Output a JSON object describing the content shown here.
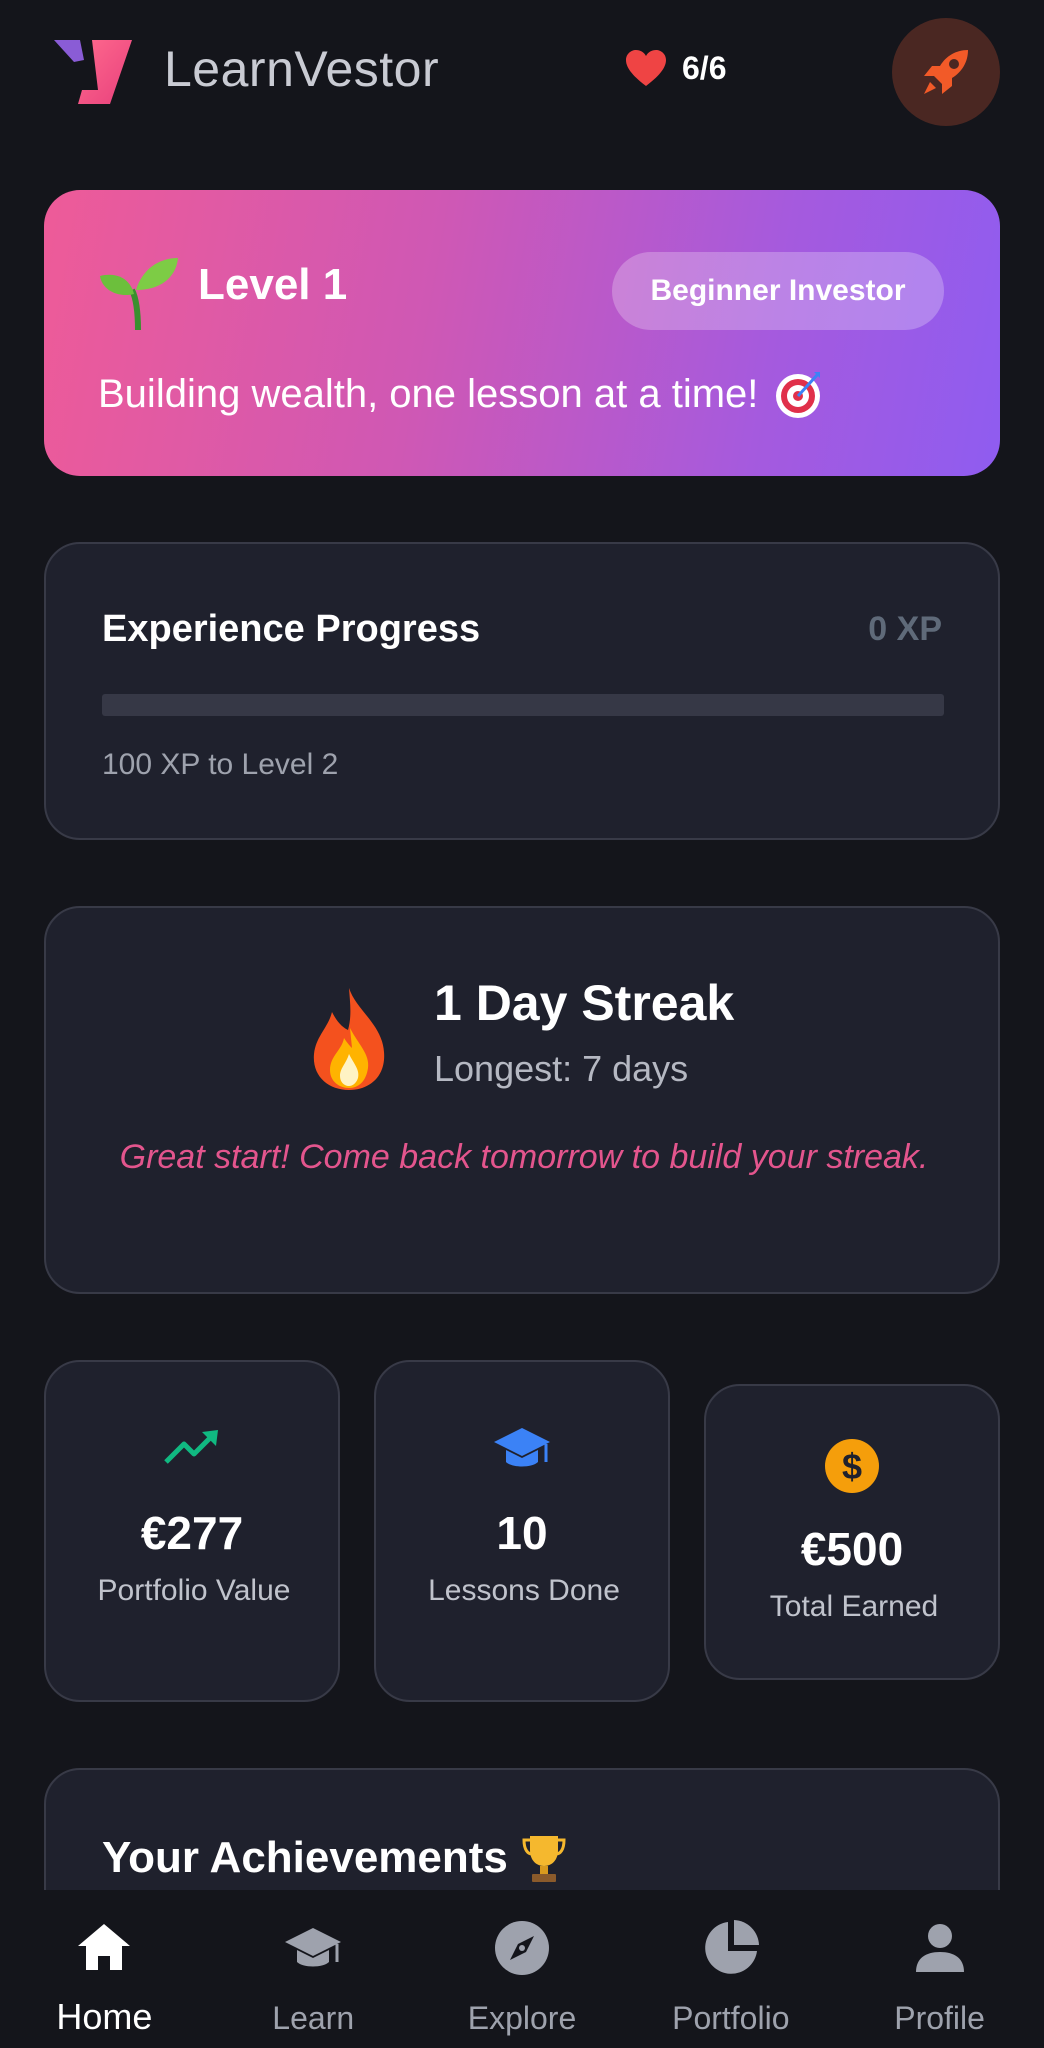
{
  "header": {
    "app_title": "LearnVestor",
    "lives": "6/6",
    "logo_icon": "learnvestor-logo-icon",
    "heart_icon": "heart-icon",
    "rocket_icon": "rocket-icon"
  },
  "level": {
    "title": "Level 1",
    "badge": "Beginner Investor",
    "tagline": "Building wealth, one lesson at a time!",
    "sprout_icon": "sprout-emoji",
    "target_icon": "target-emoji"
  },
  "xp": {
    "title": "Experience Progress",
    "value": "0 XP",
    "progress": 0,
    "subtitle": "100 XP to Level 2"
  },
  "streak": {
    "title": "1 Day Streak",
    "longest": "Longest: 7 days",
    "message": "Great start! Come back tomorrow to build your streak.",
    "flame_icon": "fire-emoji"
  },
  "stats": [
    {
      "value": "€277",
      "label": "Portfolio Value",
      "icon": "trending-up-icon",
      "color": "#10b981"
    },
    {
      "value": "10",
      "label": "Lessons Done",
      "icon": "graduation-cap-icon",
      "color": "#3b82f6"
    },
    {
      "value": "€500",
      "label": "Total Earned",
      "icon": "dollar-coin-icon",
      "color": "#f59e0b"
    }
  ],
  "achievements": {
    "title": "Your Achievements",
    "trophy_icon": "trophy-emoji"
  },
  "nav": [
    {
      "label": "Home",
      "icon": "home-icon",
      "active": true
    },
    {
      "label": "Learn",
      "icon": "graduation-cap-icon",
      "active": false
    },
    {
      "label": "Explore",
      "icon": "compass-icon",
      "active": false
    },
    {
      "label": "Portfolio",
      "icon": "pie-chart-icon",
      "active": false
    },
    {
      "label": "Profile",
      "icon": "person-icon",
      "active": false
    }
  ],
  "colors": {
    "background": "#14151b",
    "card": "#1f212d",
    "accent_pink": "#ee5b98",
    "accent_purple": "#8f5cf0",
    "streak_message": "#e3558d"
  }
}
